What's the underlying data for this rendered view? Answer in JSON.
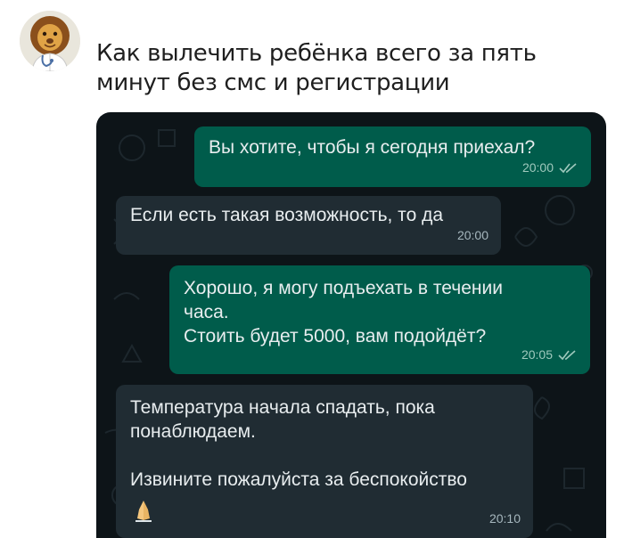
{
  "post": {
    "text": "Как вылечить ребёнка всего за пять минут без смс и регистрации"
  },
  "chat": {
    "messages": [
      {
        "direction": "out",
        "text": "Вы хотите, чтобы я сегодня приехал?",
        "time": "20:00",
        "read": true
      },
      {
        "direction": "in",
        "text": "Если есть такая возможность, то да",
        "time": "20:00"
      },
      {
        "direction": "out",
        "text": "Хорошо, я могу подъехать в течении\nчаса.\nСтоить будет 5000, вам подойдёт?",
        "time": "20:05",
        "read": true
      },
      {
        "direction": "in",
        "text": "Температура начала спадать, пока\nпонаблюдаем.\n\nИзвините пожалуйста за беспокойство",
        "time": "20:10",
        "emoji": "folded-hands-icon"
      }
    ]
  },
  "colors": {
    "outgoing_bubble": "#005c4b",
    "incoming_bubble": "#202c33",
    "chat_background": "#0d1418"
  }
}
